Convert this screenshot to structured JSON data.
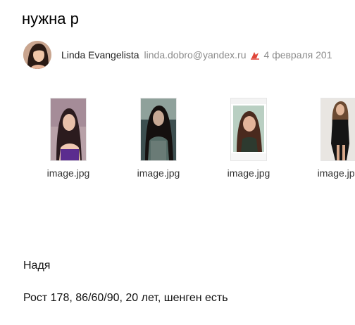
{
  "message": {
    "subject": "нужна р",
    "sender": {
      "name": "Linda Evangelista",
      "email": "linda.dobro@yandex.ru",
      "important_icon": "important-flag-icon",
      "important_color": "#e0463a"
    },
    "date": "4 февраля 201",
    "attachments": [
      {
        "file_name": "image.jpg"
      },
      {
        "file_name": "image.jpg"
      },
      {
        "file_name": "image.jpg"
      },
      {
        "file_name": "image.jpg"
      }
    ],
    "body": {
      "line1": "Надя",
      "line2": "Рост 178, 86/60/90, 20 лет, шенген есть"
    }
  }
}
